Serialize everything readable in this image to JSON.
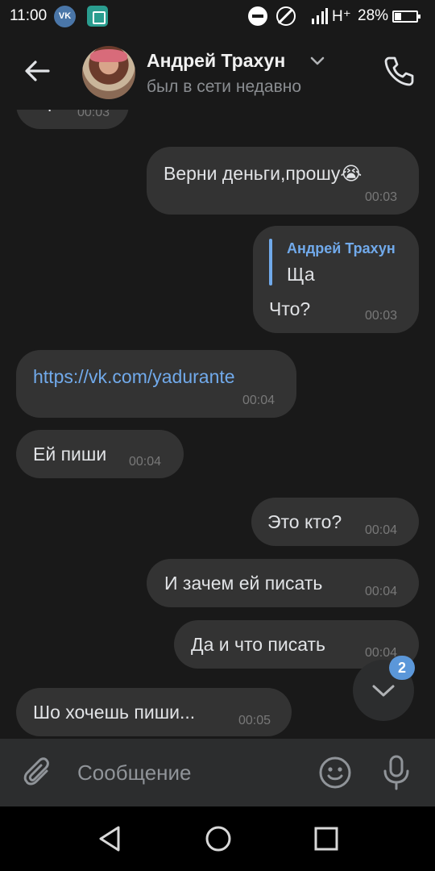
{
  "status_bar": {
    "time": "11:00",
    "vk_icon_text": "VK",
    "network": "H⁺",
    "battery": "28%"
  },
  "header": {
    "contact_name": "Андрей Трахун",
    "contact_status": "был в сети недавно"
  },
  "messages": [
    {
      "direction": "incoming",
      "text": "Ща",
      "time": "00:03"
    },
    {
      "direction": "outgoing",
      "text": "Верни деньги,прошу😭",
      "time": "00:03"
    },
    {
      "direction": "outgoing",
      "reply_author": "Андрей Трахун",
      "reply_text": "Ща",
      "text": "Что?",
      "time": "00:03"
    },
    {
      "direction": "incoming",
      "text": "https://vk.com/yadurante",
      "time": "00:04",
      "is_link": true
    },
    {
      "direction": "incoming",
      "text": "Ей пиши",
      "time": "00:04"
    },
    {
      "direction": "outgoing",
      "text": "Это кто?",
      "time": "00:04"
    },
    {
      "direction": "outgoing",
      "text": "И зачем ей писать",
      "time": "00:04"
    },
    {
      "direction": "outgoing",
      "text": "Да и что писать",
      "time": "00:04"
    },
    {
      "direction": "incoming",
      "text": "Шо хочешь пиши...",
      "time": "00:05"
    }
  ],
  "scroll_down": {
    "unread_count": "2"
  },
  "composer": {
    "placeholder": "Сообщение"
  },
  "colors": {
    "background": "#191919",
    "bubble": "#333333",
    "link": "#71aaeb",
    "badge": "#5b97d9"
  },
  "icons": [
    "vk-icon",
    "scan-icon",
    "dnd-icon",
    "no-sim-icon",
    "signal-icon",
    "battery-icon",
    "back-arrow-icon",
    "chevron-down-icon",
    "phone-icon",
    "paperclip-icon",
    "emoji-icon",
    "microphone-icon",
    "nav-back-icon",
    "nav-home-icon",
    "nav-recents-icon"
  ]
}
